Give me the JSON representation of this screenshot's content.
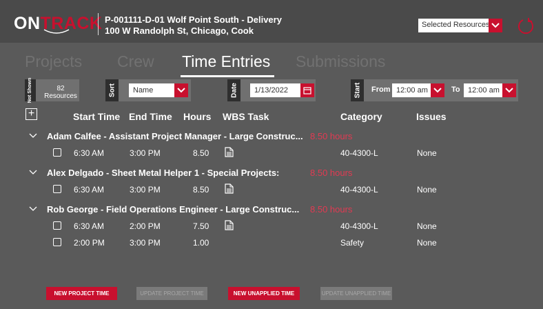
{
  "header": {
    "logo_on": "ON",
    "logo_track": "TRACK",
    "project_line1": "P-001111-D-01 Wolf Point South - Delivery",
    "project_line2": "100 W Randolph St, Chicago, Cook",
    "resource_select": "Selected Resources"
  },
  "tabs": [
    "Projects",
    "Crew",
    "Time Entries",
    "Submissions"
  ],
  "filters": {
    "not_shown_label": "Not Shown",
    "resources_count": "82",
    "resources_label": "Resources",
    "sort_label": "Sort",
    "sort_value": "Name",
    "date_label": "Date",
    "date_value": "1/13/2022",
    "start_label": "Start",
    "from_label": "From",
    "from_value": "12:00 am",
    "to_label": "To",
    "to_value": "12:00 am"
  },
  "columns": {
    "add": "+",
    "start_time": "Start Time",
    "end_time": "End Time",
    "hours": "Hours",
    "wbs_task": "WBS Task",
    "category": "Category",
    "issues": "Issues"
  },
  "groups": [
    {
      "name": "Adam Calfee -  Assistant Project Manager - Large Construc...",
      "hours": "8.50 hours",
      "rows": [
        {
          "start": "6:30 AM",
          "end": "3:00 PM",
          "hours": "8.50",
          "category": "40-4300-L",
          "issues": "None"
        }
      ]
    },
    {
      "name": "Alex Delgado -  Sheet Metal Helper 1 - Special Projects:",
      "hours": "8.50 hours",
      "rows": [
        {
          "start": "6:30 AM",
          "end": "3:00 PM",
          "hours": "8.50",
          "category": "40-4300-L",
          "issues": "None"
        }
      ]
    },
    {
      "name": "Rob George -  Field Operations Engineer - Large Construc...",
      "hours": "8.50 hours",
      "rows": [
        {
          "start": "6:30 AM",
          "end": "2:00 PM",
          "hours": "7.50",
          "category": "40-4300-L",
          "issues": "None"
        },
        {
          "start": "2:00 PM",
          "end": "3:00 PM",
          "hours": "1.00",
          "category": "Safety",
          "issues": "None"
        }
      ]
    }
  ],
  "buttons": {
    "new_project_time": "NEW PROJECT TIME",
    "update_project_time": "UPDATE PROJECT TIME",
    "new_unapplied_time": "NEW UNAPPLIED TIME",
    "update_unapplied_time": "UPDATE UNAPPLIED TIME"
  },
  "colors": {
    "accent": "#c8102e",
    "hours_text": "#e23a52",
    "background": "#5a5a5a",
    "header": "#4a4a4a"
  },
  "icons": [
    "chevron-down-icon",
    "refresh-icon",
    "calendar-icon",
    "document-icon",
    "checkbox-icon",
    "plus-icon"
  ]
}
